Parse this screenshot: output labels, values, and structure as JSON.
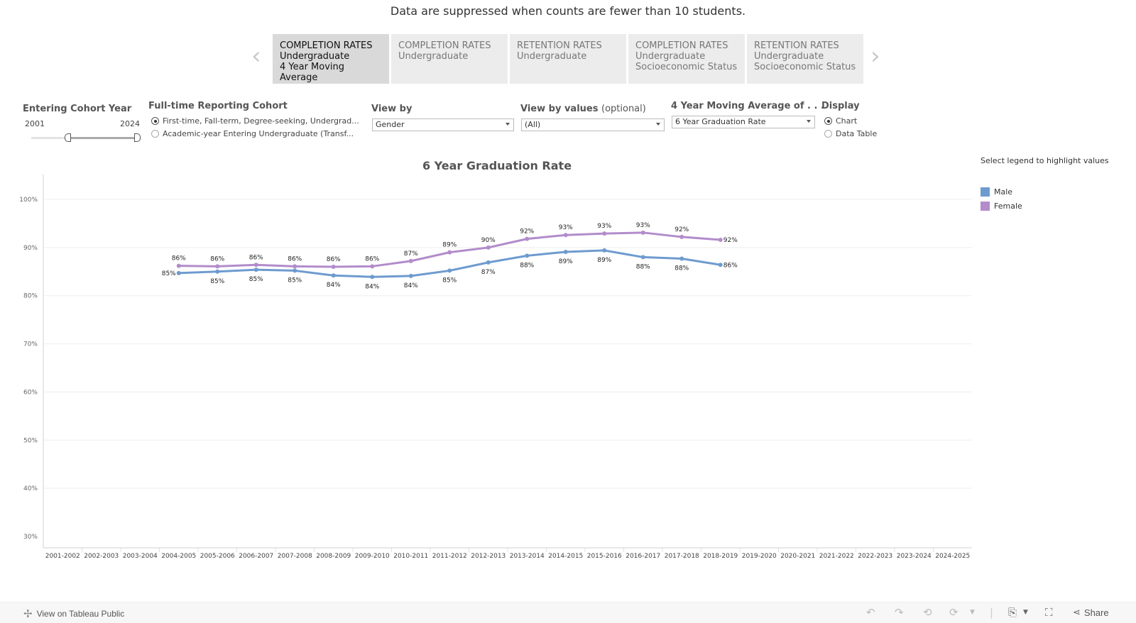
{
  "notice": "Data are suppressed when counts are fewer than 10 students.",
  "tabs": [
    {
      "lines": [
        "COMPLETION RATES",
        "Undergraduate",
        "4 Year Moving",
        "Average"
      ],
      "active": true
    },
    {
      "lines": [
        "COMPLETION RATES",
        "Undergraduate"
      ],
      "active": false
    },
    {
      "lines": [
        "RETENTION RATES",
        "Undergraduate"
      ],
      "active": false
    },
    {
      "lines": [
        "COMPLETION RATES",
        "Undergraduate",
        "Socioeconomic Status"
      ],
      "active": false
    },
    {
      "lines": [
        "RETENTION RATES",
        "Undergraduate",
        "Socioeconomic Status"
      ],
      "active": false
    }
  ],
  "nav": {
    "prev_icon": "chevron-left-icon",
    "next_icon": "chevron-right-icon",
    "prev": "‹",
    "next": "›"
  },
  "filters": {
    "cohort_year": {
      "label": "Entering Cohort Year",
      "min": "2001",
      "max": "2024",
      "selected_start": "2010",
      "selected_end": "2024"
    },
    "reporting_cohort": {
      "label": "Full-time Reporting Cohort",
      "options": [
        {
          "label": "First-time, Fall-term, Degree-seeking, Undergrad...",
          "selected": true
        },
        {
          "label": "Academic-year Entering Undergraduate (Transf...",
          "selected": false
        }
      ]
    },
    "view_by": {
      "label": "View by",
      "value": "Gender"
    },
    "view_by_values": {
      "label": "View by values",
      "label_suffix": "(optional)",
      "value": "(All)"
    },
    "moving_average": {
      "label": "4 Year Moving Average of . . .",
      "value": "6 Year Graduation Rate"
    },
    "display": {
      "label": "Display",
      "options": [
        {
          "label": "Chart",
          "selected": true
        },
        {
          "label": "Data Table",
          "selected": false
        }
      ]
    }
  },
  "legend": {
    "title": "Select legend to highlight values",
    "items": [
      {
        "label": "Male",
        "color": "#6e9bcf"
      },
      {
        "label": "Female",
        "color": "#b28ccb"
      }
    ]
  },
  "chart_data": {
    "type": "line",
    "title": "6 Year Graduation Rate",
    "xlabel": "",
    "ylabel": "",
    "ylim": [
      30,
      100
    ],
    "yticks": [
      30,
      40,
      50,
      60,
      70,
      80,
      90,
      100
    ],
    "ytick_labels": [
      "30%",
      "40%",
      "50%",
      "60%",
      "70%",
      "80%",
      "90%",
      "100%"
    ],
    "grid": true,
    "legend_position": "right",
    "categories": [
      "2001-2002",
      "2002-2003",
      "2003-2004",
      "2004-2005",
      "2005-2006",
      "2006-2007",
      "2007-2008",
      "2008-2009",
      "2009-2010",
      "2010-2011",
      "2011-2012",
      "2012-2013",
      "2013-2014",
      "2014-2015",
      "2015-2016",
      "2016-2017",
      "2017-2018",
      "2018-2019",
      "2019-2020",
      "2020-2021",
      "2021-2022",
      "2022-2023",
      "2023-2024",
      "2024-2025"
    ],
    "series": [
      {
        "name": "Male",
        "color": "#6e9bcf",
        "values": [
          null,
          null,
          null,
          84.7,
          85.0,
          85.4,
          85.2,
          84.2,
          83.9,
          84.1,
          85.2,
          86.9,
          88.3,
          89.1,
          89.4,
          88.0,
          87.7,
          86.4,
          null,
          null,
          null,
          null,
          null,
          null
        ],
        "labels": [
          null,
          null,
          null,
          "85%",
          "85%",
          "85%",
          "85%",
          "84%",
          "84%",
          "84%",
          "85%",
          "87%",
          "88%",
          "89%",
          "89%",
          "88%",
          "88%",
          "86%",
          null,
          null,
          null,
          null,
          null,
          null
        ]
      },
      {
        "name": "Female",
        "color": "#b28ccb",
        "values": [
          null,
          null,
          null,
          86.2,
          86.1,
          86.4,
          86.1,
          86.0,
          86.1,
          87.2,
          89.0,
          90.0,
          91.8,
          92.6,
          92.9,
          93.1,
          92.2,
          91.6,
          null,
          null,
          null,
          null,
          null,
          null
        ],
        "labels": [
          null,
          null,
          null,
          "86%",
          "86%",
          "86%",
          "86%",
          "86%",
          "86%",
          "87%",
          "89%",
          "90%",
          "92%",
          "93%",
          "93%",
          "93%",
          "92%",
          "92%",
          null,
          null,
          null,
          null,
          null,
          null
        ]
      }
    ]
  },
  "footer": {
    "view_link": "View on Tableau Public",
    "share": "Share"
  }
}
